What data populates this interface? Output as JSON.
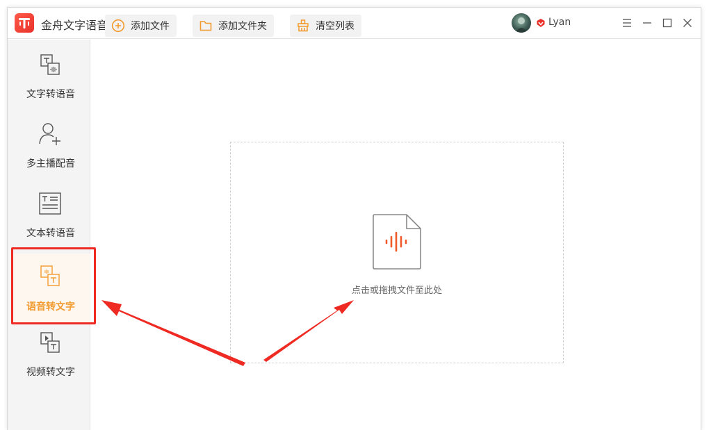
{
  "app": {
    "title": "金舟文字语音转换软件",
    "brand_color": "#ee3a2e"
  },
  "user": {
    "name": "Lyan",
    "vip_icon": "vip-diamond-icon"
  },
  "window_controls": {
    "icons": [
      "menu-icon",
      "minimize-icon",
      "maximize-icon",
      "close-icon"
    ]
  },
  "sidebar": {
    "items": [
      {
        "label": "文字转语音",
        "icon": "text-to-speech-icon"
      },
      {
        "label": "多主播配音",
        "icon": "multi-speaker-icon"
      },
      {
        "label": "文本转语音",
        "icon": "document-to-speech-icon"
      },
      {
        "label": "语音转文字",
        "icon": "speech-to-text-icon",
        "active": true
      },
      {
        "label": "视频转文字",
        "icon": "video-to-text-icon"
      }
    ],
    "active_color": "#f29a2e",
    "highlight_color": "#ee2a22"
  },
  "toolbar": {
    "add_file_label": "添加文件",
    "add_folder_label": "添加文件夹",
    "clear_list_label": "清空列表",
    "icon_color": "#f29a2e"
  },
  "dropzone": {
    "hint": "点击或拖拽文件至此处",
    "icon": "audio-file-icon",
    "waveform_color": "#f05a28"
  },
  "annotations": {
    "arrow_color": "#ee2a22"
  }
}
